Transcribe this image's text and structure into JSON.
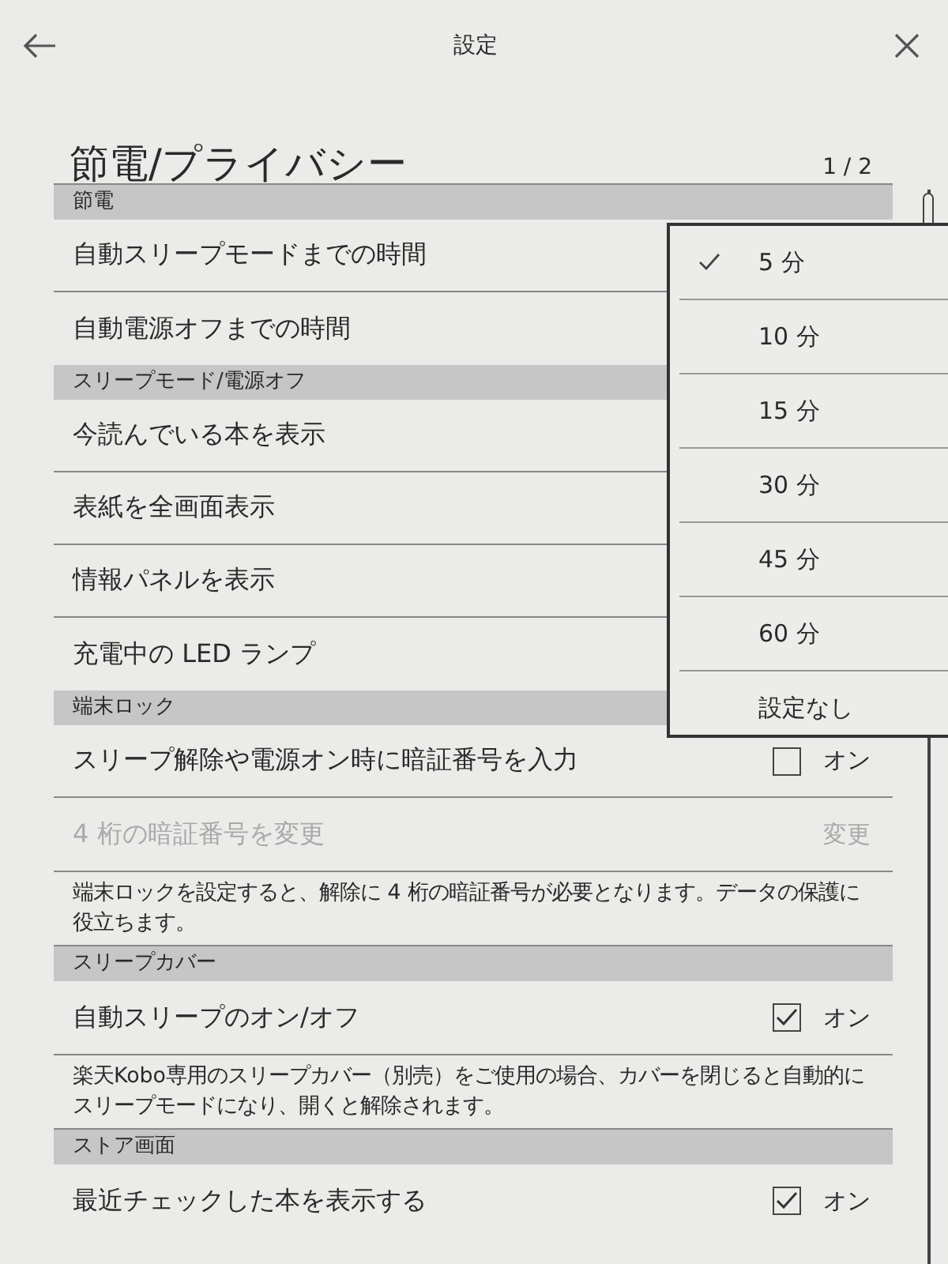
{
  "top_bar": {
    "title": "設定"
  },
  "page": {
    "title": "節電/プライバシー",
    "page_indicator": "1 / 2"
  },
  "sections": [
    {
      "title": "節電",
      "items": [
        {
          "kind": "row",
          "label": "自動スリープモードまでの時間"
        },
        {
          "kind": "row",
          "label": "自動電源オフまでの時間"
        }
      ]
    },
    {
      "title": "スリープモード/電源オフ",
      "items": [
        {
          "kind": "row",
          "label": "今読んでいる本を表示"
        },
        {
          "kind": "row",
          "label": "表紙を全画面表示"
        },
        {
          "kind": "row",
          "label": "情報パネルを表示"
        },
        {
          "kind": "row",
          "label": "充電中の LED ランプ"
        }
      ]
    },
    {
      "title": "端末ロック",
      "items": [
        {
          "kind": "toggle",
          "label": "スリープ解除や電源オン時に暗証番号を入力",
          "checked": false,
          "value_label": "オン"
        },
        {
          "kind": "action",
          "label": "4 桁の暗証番号を変更",
          "action_label": "変更",
          "disabled": true
        },
        {
          "kind": "note",
          "label": "端末ロックを設定すると、解除に 4 桁の暗証番号が必要となります。データの保護に役立ちます。"
        }
      ]
    },
    {
      "title": "スリープカバー",
      "items": [
        {
          "kind": "toggle",
          "label": "自動スリープのオン/オフ",
          "checked": true,
          "value_label": "オン"
        },
        {
          "kind": "note",
          "label": "楽天Kobo専用のスリープカバー（別売）をご使用の場合、カバーを閉じると自動的にスリープモードになり、開くと解除されます。"
        }
      ]
    },
    {
      "title": "ストア画面",
      "items": [
        {
          "kind": "toggle",
          "label": "最近チェックした本を表示する",
          "checked": true,
          "value_label": "オン"
        }
      ]
    }
  ],
  "dropdown": {
    "options": [
      {
        "label": "5 分",
        "selected": true
      },
      {
        "label": "10 分",
        "selected": false
      },
      {
        "label": "15 分",
        "selected": false
      },
      {
        "label": "30 分",
        "selected": false
      },
      {
        "label": "45 分",
        "selected": false
      },
      {
        "label": "60 分",
        "selected": false
      },
      {
        "label": "設定なし",
        "selected": false
      }
    ]
  }
}
